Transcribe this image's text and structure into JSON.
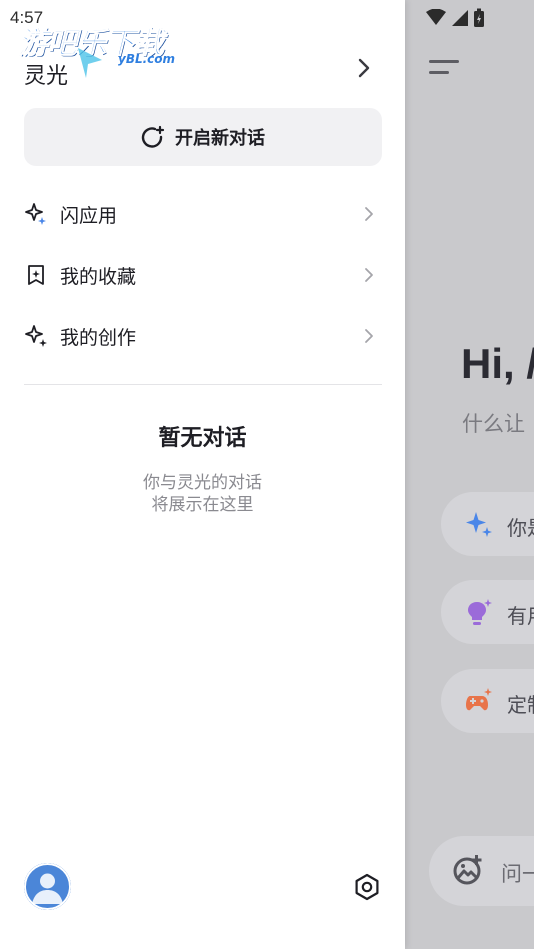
{
  "status": {
    "time": "4:57"
  },
  "watermark": {
    "text": "游吧乐下载",
    "sub": "yBL.com"
  },
  "drawer": {
    "app_name": "灵光",
    "new_chat_label": "开启新对话",
    "nav": [
      {
        "label": "闪应用",
        "icon": "sparkle-app-icon"
      },
      {
        "label": "我的收藏",
        "icon": "bookmark-icon"
      },
      {
        "label": "我的创作",
        "icon": "creation-sparkle-icon"
      }
    ],
    "empty_title": "暂无对话",
    "empty_desc_line1": "你与灵光的对话",
    "empty_desc_line2": "将展示在这里"
  },
  "main": {
    "greeting": "Hi, /",
    "subtitle": "什么让",
    "chips": [
      {
        "label": "你是",
        "icon": "blue-sparkle-icon"
      },
      {
        "label": "有用",
        "icon": "lightbulb-icon"
      },
      {
        "label": "定制",
        "icon": "game-controller-icon"
      }
    ],
    "ask_placeholder": "问一"
  },
  "colors": {
    "accent_blue": "#4a86e8",
    "purple": "#9b6bd9",
    "orange": "#e8744a",
    "dim_overlay": "#c9c9cc"
  }
}
